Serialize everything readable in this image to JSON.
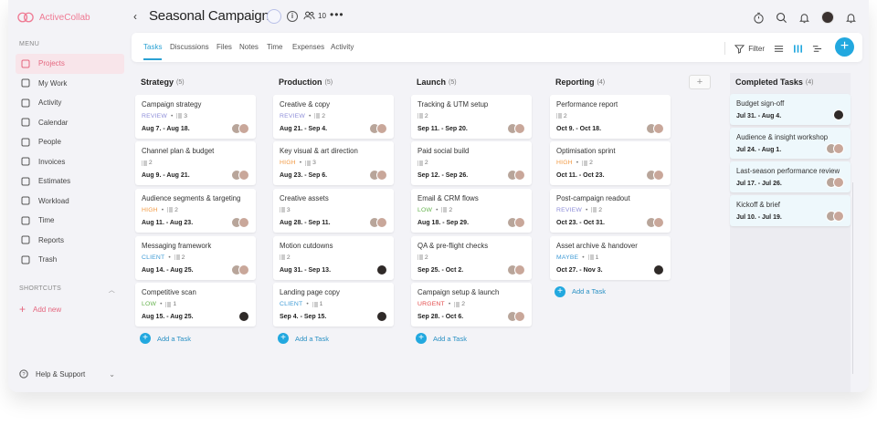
{
  "app": {
    "name": "ActiveCollab"
  },
  "sidebar": {
    "menu_heading": "MENU",
    "items": [
      {
        "label": "Projects",
        "icon": "projects-icon",
        "active": true
      },
      {
        "label": "My Work",
        "icon": "my-work-icon"
      },
      {
        "label": "Activity",
        "icon": "activity-icon"
      },
      {
        "label": "Calendar",
        "icon": "calendar-icon"
      },
      {
        "label": "People",
        "icon": "people-icon"
      },
      {
        "label": "Invoices",
        "icon": "invoices-icon"
      },
      {
        "label": "Estimates",
        "icon": "estimates-icon"
      },
      {
        "label": "Workload",
        "icon": "workload-icon"
      },
      {
        "label": "Time",
        "icon": "time-icon"
      },
      {
        "label": "Reports",
        "icon": "reports-icon"
      },
      {
        "label": "Trash",
        "icon": "trash-icon"
      }
    ],
    "shortcuts_heading": "SHORTCUTS",
    "add_new": "Add new",
    "help": "Help & Support"
  },
  "header": {
    "title": "Seasonal Campaign",
    "people_count": "10"
  },
  "tabs": [
    "Tasks",
    "Discussions",
    "Files",
    "Notes",
    "Time",
    "Expenses",
    "Activity"
  ],
  "toolbar": {
    "filter": "Filter"
  },
  "colors": {
    "accent": "#22a8df",
    "brand": "#ef7b94",
    "review": "#8f8fd9",
    "high": "#f29a43",
    "client": "#3f9bd6",
    "low": "#66b34e",
    "urgent": "#e34b4b",
    "maybe": "#3f9bd6"
  },
  "board": {
    "add_task": "Add a Task",
    "columns": [
      {
        "name": "Strategy",
        "count": "(5)",
        "cards": [
          {
            "name": "Campaign strategy",
            "label": "REVIEW",
            "label_color": "#8f8fd9",
            "subtasks": "3",
            "dates": "Aug 7. - Aug 18.",
            "avatars": 2
          },
          {
            "name": "Channel plan & budget",
            "label": "",
            "label_color": "",
            "subtasks": "2",
            "dates": "Aug 9. - Aug 21.",
            "avatars": 2
          },
          {
            "name": "Audience segments & targeting",
            "label": "HIGH",
            "label_color": "#f29a43",
            "subtasks": "2",
            "dates": "Aug 11. - Aug 23.",
            "avatars": 2
          },
          {
            "name": "Messaging framework",
            "label": "CLIENT",
            "label_color": "#3f9bd6",
            "subtasks": "2",
            "dates": "Aug 14. - Aug 25.",
            "avatars": 2
          },
          {
            "name": "Competitive scan",
            "label": "LOW",
            "label_color": "#66b34e",
            "subtasks": "1",
            "dates": "Aug 15. - Aug 25.",
            "avatars": 1
          }
        ]
      },
      {
        "name": "Production",
        "count": "(5)",
        "cards": [
          {
            "name": "Creative & copy",
            "label": "REVIEW",
            "label_color": "#8f8fd9",
            "subtasks": "2",
            "dates": "Aug 21. - Sep 4.",
            "avatars": 2
          },
          {
            "name": "Key visual & art direction",
            "label": "HIGH",
            "label_color": "#f29a43",
            "subtasks": "3",
            "dates": "Aug 23. - Sep 6.",
            "avatars": 2
          },
          {
            "name": "Creative assets",
            "label": "",
            "label_color": "",
            "subtasks": "3",
            "dates": "Aug 28. - Sep 11.",
            "avatars": 2
          },
          {
            "name": "Motion cutdowns",
            "label": "",
            "label_color": "",
            "subtasks": "2",
            "dates": "Aug 31. - Sep 13.",
            "avatars": 1
          },
          {
            "name": "Landing page copy",
            "label": "CLIENT",
            "label_color": "#3f9bd6",
            "subtasks": "1",
            "dates": "Sep 4. - Sep 15.",
            "avatars": 1
          }
        ]
      },
      {
        "name": "Launch",
        "count": "(5)",
        "cards": [
          {
            "name": "Tracking & UTM setup",
            "label": "",
            "label_color": "",
            "subtasks": "2",
            "dates": "Sep 11. - Sep 20.",
            "avatars": 2
          },
          {
            "name": "Paid social build",
            "label": "",
            "label_color": "",
            "subtasks": "2",
            "dates": "Sep 12. - Sep 26.",
            "avatars": 2
          },
          {
            "name": "Email & CRM flows",
            "label": "LOW",
            "label_color": "#66b34e",
            "subtasks": "2",
            "dates": "Aug 18. - Sep 29.",
            "avatars": 2
          },
          {
            "name": "QA & pre-flight checks",
            "label": "",
            "label_color": "",
            "subtasks": "2",
            "dates": "Sep 25. - Oct 2.",
            "avatars": 2
          },
          {
            "name": "Campaign setup & launch",
            "label": "URGENT",
            "label_color": "#e34b4b",
            "subtasks": "2",
            "dates": "Sep 28. - Oct 6.",
            "avatars": 2
          }
        ]
      },
      {
        "name": "Reporting",
        "count": "(4)",
        "cards": [
          {
            "name": "Performance report",
            "label": "",
            "label_color": "",
            "subtasks": "2",
            "dates": "Oct 9. - Oct 18.",
            "avatars": 2
          },
          {
            "name": "Optimisation sprint",
            "label": "HIGH",
            "label_color": "#f29a43",
            "subtasks": "2",
            "dates": "Oct 11. - Oct 23.",
            "avatars": 2
          },
          {
            "name": "Post-campaign readout",
            "label": "REVIEW",
            "label_color": "#8f8fd9",
            "subtasks": "2",
            "dates": "Oct 23. - Oct 31.",
            "avatars": 2
          },
          {
            "name": "Asset archive & handover",
            "label": "MAYBE",
            "label_color": "#3f9bd6",
            "subtasks": "1",
            "dates": "Oct 27. - Nov 3.",
            "avatars": 1
          }
        ]
      }
    ],
    "completed": {
      "name": "Completed Tasks",
      "count": "(4)",
      "cards": [
        {
          "name": "Budget sign-off",
          "dates": "Jul 31. - Aug 4.",
          "avatars": 1
        },
        {
          "name": "Audience & insight workshop",
          "dates": "Jul 24. - Aug 1.",
          "avatars": 2
        },
        {
          "name": "Last-season performance review",
          "dates": "Jul 17. - Jul 26.",
          "avatars": 2
        },
        {
          "name": "Kickoff & brief",
          "dates": "Jul 10. - Jul 19.",
          "avatars": 2
        }
      ]
    }
  }
}
